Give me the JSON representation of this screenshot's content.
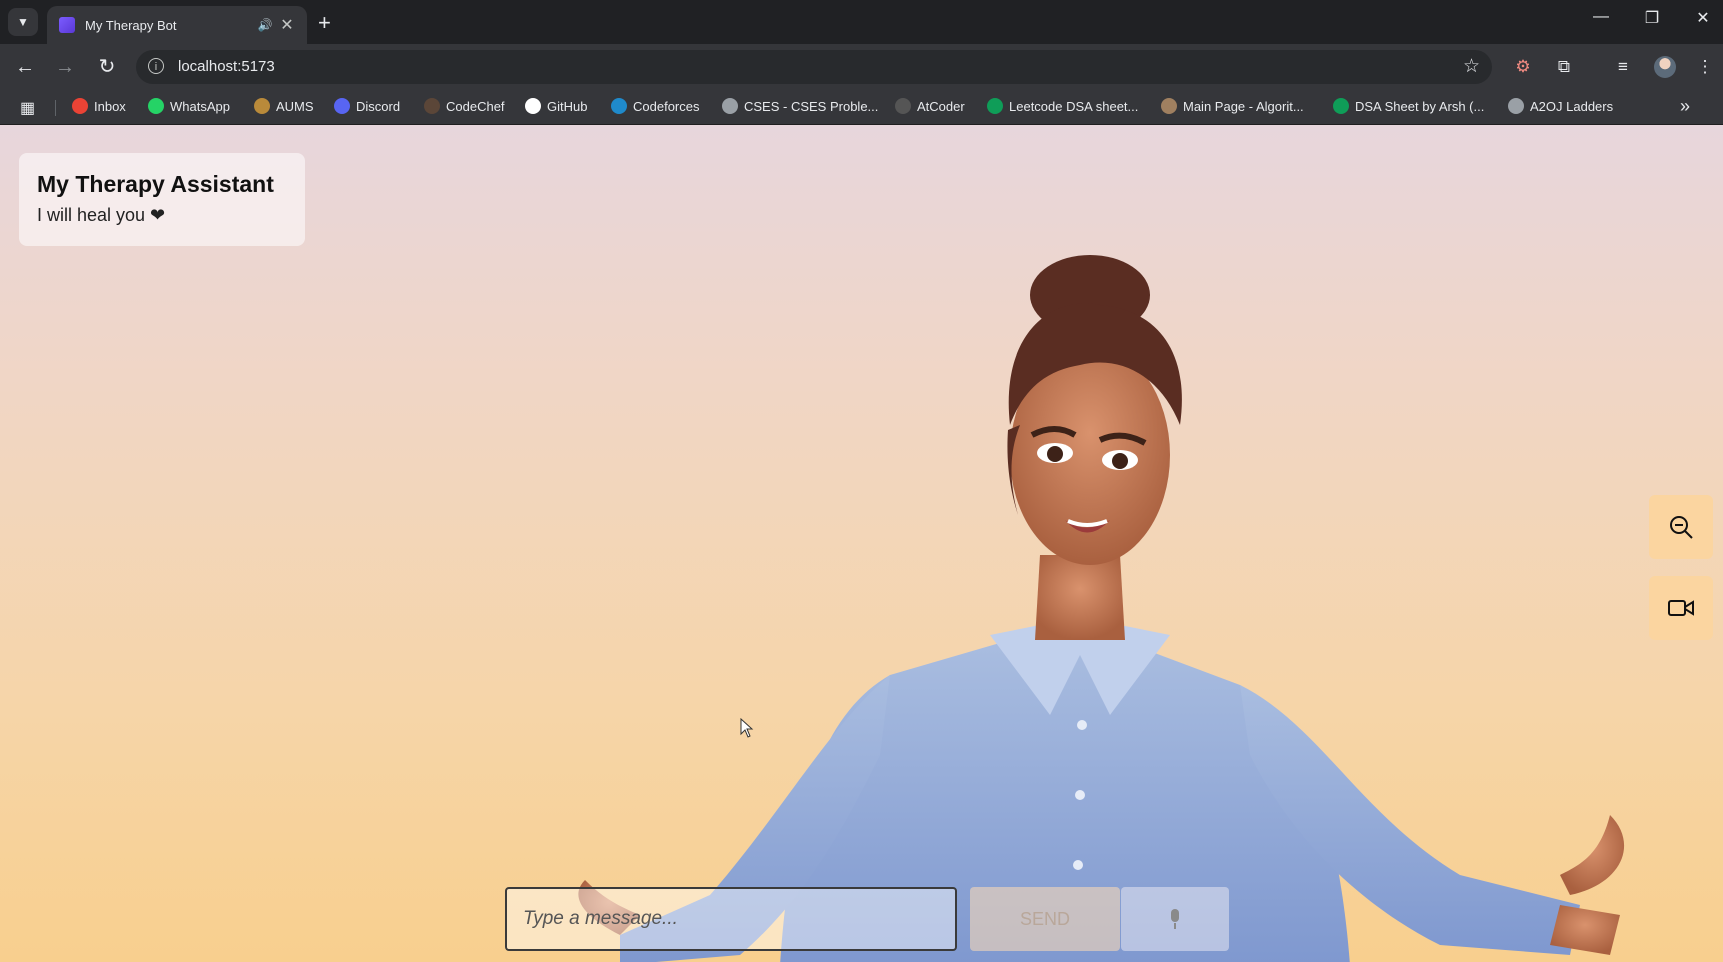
{
  "browser": {
    "tab_title": "My Therapy Bot",
    "url": "localhost:5173",
    "bookmarks": [
      {
        "label": "Inbox",
        "icon": "gmail-icon",
        "color": "#ea4335"
      },
      {
        "label": "WhatsApp",
        "icon": "whatsapp-icon",
        "color": "#25d366"
      },
      {
        "label": "AUMS",
        "icon": "aums-icon",
        "color": "#b98a3a"
      },
      {
        "label": "Discord",
        "icon": "discord-icon",
        "color": "#5865f2"
      },
      {
        "label": "CodeChef",
        "icon": "codechef-icon",
        "color": "#5b4638"
      },
      {
        "label": "GitHub",
        "icon": "github-icon",
        "color": "#ffffff"
      },
      {
        "label": "Codeforces",
        "icon": "codeforces-icon",
        "color": "#1f8acb"
      },
      {
        "label": "CSES - CSES Proble...",
        "icon": "globe-icon",
        "color": "#9aa0a6"
      },
      {
        "label": "AtCoder",
        "icon": "atcoder-icon",
        "color": "#555555"
      },
      {
        "label": "Leetcode DSA sheet...",
        "icon": "sheets-icon",
        "color": "#0f9d58"
      },
      {
        "label": "Main Page - Algorit...",
        "icon": "algorithmica-icon",
        "color": "#a08060"
      },
      {
        "label": "DSA Sheet by Arsh (...",
        "icon": "sheets-icon",
        "color": "#0f9d58"
      },
      {
        "label": "A2OJ Ladders",
        "icon": "globe-icon",
        "color": "#9aa0a6"
      }
    ]
  },
  "app": {
    "title": "My Therapy Assistant",
    "subtitle": "I will heal you ❤",
    "zoom_button_icon": "zoom-out-icon",
    "video_button_icon": "video-camera-icon",
    "message_placeholder": "Type a message...",
    "send_label": "SEND",
    "mic_icon": "microphone-icon"
  },
  "colors": {
    "accent_button": "#fbd5a0",
    "background_top": "#e7d6dc",
    "background_bottom": "#f8cf8e"
  }
}
